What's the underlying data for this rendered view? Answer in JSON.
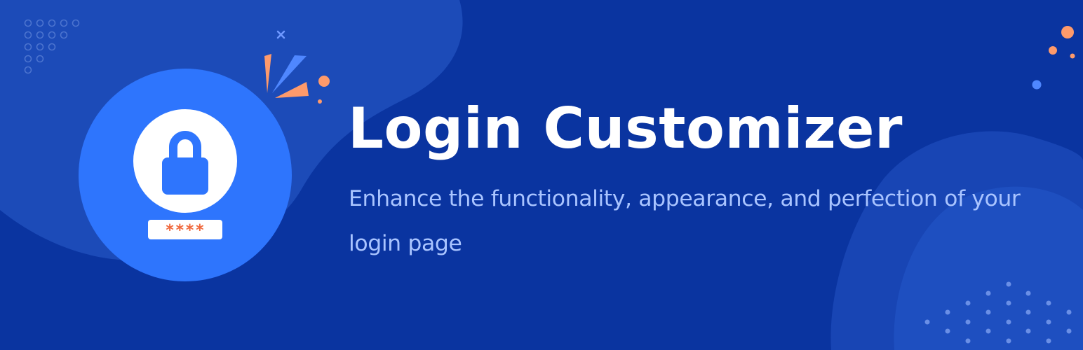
{
  "banner": {
    "title": "Login Customizer",
    "subtitle": "Enhance the functionality, appearance, and perfection of your login page",
    "icon": {
      "name": "lock-icon",
      "password_mask": "****"
    }
  },
  "colors": {
    "background": "#0a34a0",
    "circle": "#2e75fd",
    "accent_orange": "#fe9a6b",
    "accent_blue": "#4f87ff",
    "title": "#ffffff",
    "subtitle": "#a9c4ff"
  }
}
